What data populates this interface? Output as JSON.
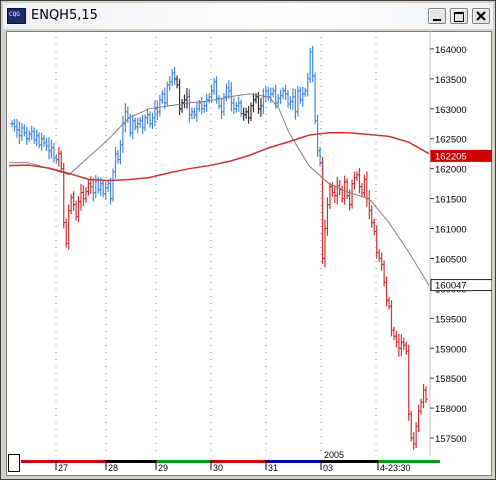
{
  "window": {
    "title": "ENQH5,15",
    "icon": "cqg-logo-icon",
    "icon_text": "CQG",
    "buttons": [
      "minimize-button",
      "maximize-button",
      "close-button"
    ]
  },
  "chart_data": {
    "type": "bar",
    "subtype": "ohlc",
    "symbol": "ENQH5",
    "interval": "15",
    "ylim": [
      15720,
      16430
    ],
    "y_ticks": [
      16400,
      16350,
      16300,
      16250,
      16200,
      16150,
      16100,
      16050,
      16000,
      15950,
      15900,
      15850,
      15800,
      15750
    ],
    "y_tick_labels": [
      "164000",
      "163500",
      "163000",
      "162500",
      "162000",
      "161500",
      "161000",
      "160500",
      "160000",
      "159500",
      "159000",
      "158500",
      "158000",
      "157500"
    ],
    "price_markers": [
      {
        "label": "162205",
        "value": 16220.5,
        "color": "#cc0000"
      },
      {
        "label": "160047",
        "value": 16004.7,
        "color": "#202020"
      }
    ],
    "date_axis": {
      "year_label": "2005",
      "segments": [
        {
          "label": "27",
          "color": "#cc0000"
        },
        {
          "label": "28",
          "color": "#000000"
        },
        {
          "label": "29",
          "color": "#00a000"
        },
        {
          "label": "30",
          "color": "#cc0000"
        },
        {
          "label": "31",
          "color": "#0000aa"
        },
        {
          "label": "03",
          "color": "#000000"
        },
        {
          "label": "4-23:30",
          "color": "#00a000"
        }
      ]
    },
    "series": [
      {
        "kind": "ohlc_bars",
        "up_color": "#4488dd",
        "down_color": "#cc3333",
        "neutral_color": "#303030",
        "close": [
          16275,
          16270,
          16265,
          16255,
          16268,
          16260,
          16250,
          16258,
          16262,
          16248,
          16255,
          16240,
          16250,
          16243,
          16238,
          16230,
          16235,
          16218,
          16215,
          16225,
          16200,
          16110,
          16075,
          16130,
          16152,
          16140,
          16120,
          16145,
          16160,
          16150,
          16162,
          16175,
          16170,
          16160,
          16180,
          16165,
          16175,
          16158,
          16168,
          16175,
          16150,
          16195,
          16225,
          16215,
          16240,
          16275,
          16295,
          16285,
          16260,
          16280,
          16270,
          16275,
          16280,
          16268,
          16285,
          16290,
          16275,
          16285,
          16300,
          16295,
          16315,
          16325,
          16310,
          16340,
          16345,
          16360,
          16350,
          16340,
          16300,
          16310,
          16315,
          16320,
          16290,
          16295,
          16290,
          16300,
          16310,
          16300,
          16305,
          16315,
          16320,
          16330,
          16345,
          16318,
          16305,
          16295,
          16320,
          16335,
          16330,
          16310,
          16300,
          16305,
          16310,
          16292,
          16290,
          16295,
          16285,
          16305,
          16315,
          16320,
          16300,
          16305,
          16320,
          16330,
          16320,
          16325,
          16330,
          16310,
          16318,
          16322,
          16330,
          16325,
          16308,
          16312,
          16320,
          16295,
          16330,
          16315,
          16325,
          16330,
          16350,
          16395,
          16355,
          16280,
          16230,
          16210,
          16050,
          16100,
          16140,
          16170,
          16160,
          16155,
          16172,
          16165,
          16150,
          16178,
          16155,
          16140,
          16175,
          16185,
          16190,
          16170,
          16160,
          16182,
          16150,
          16130,
          16110,
          16095,
          16060,
          16050,
          16040,
          16010,
          15980,
          15970,
          15930,
          15920,
          15910,
          15900,
          15910,
          15905,
          15895,
          15790,
          15750,
          15740,
          15770,
          15795,
          15810,
          15830,
          15815
        ]
      },
      {
        "kind": "moving_average",
        "name": "",
        "color": "#808080",
        "points": [
          [
            0,
            16210
          ],
          [
            20,
            16210
          ],
          [
            40,
            16200
          ],
          [
            60,
            16190
          ],
          [
            80,
            16220
          ],
          [
            100,
            16250
          ],
          [
            120,
            16285
          ],
          [
            140,
            16300
          ],
          [
            160,
            16305
          ],
          [
            180,
            16310
          ],
          [
            200,
            16313
          ],
          [
            220,
            16320
          ],
          [
            240,
            16325
          ],
          [
            260,
            16320
          ],
          [
            270,
            16300
          ],
          [
            280,
            16260
          ],
          [
            300,
            16205
          ],
          [
            320,
            16175
          ],
          [
            340,
            16160
          ],
          [
            360,
            16150
          ],
          [
            380,
            16110
          ],
          [
            400,
            16060
          ],
          [
            420,
            16005
          ]
        ]
      },
      {
        "kind": "moving_average",
        "name": "",
        "color": "#cc3333",
        "points": [
          [
            0,
            16205
          ],
          [
            20,
            16206
          ],
          [
            40,
            16201
          ],
          [
            60,
            16192
          ],
          [
            80,
            16182
          ],
          [
            100,
            16180
          ],
          [
            120,
            16182
          ],
          [
            140,
            16185
          ],
          [
            160,
            16193
          ],
          [
            180,
            16200
          ],
          [
            200,
            16205
          ],
          [
            220,
            16212
          ],
          [
            240,
            16222
          ],
          [
            260,
            16235
          ],
          [
            280,
            16245
          ],
          [
            300,
            16256
          ],
          [
            320,
            16260
          ],
          [
            340,
            16260
          ],
          [
            360,
            16257
          ],
          [
            380,
            16254
          ],
          [
            400,
            16244
          ],
          [
            420,
            16225
          ]
        ]
      }
    ]
  }
}
